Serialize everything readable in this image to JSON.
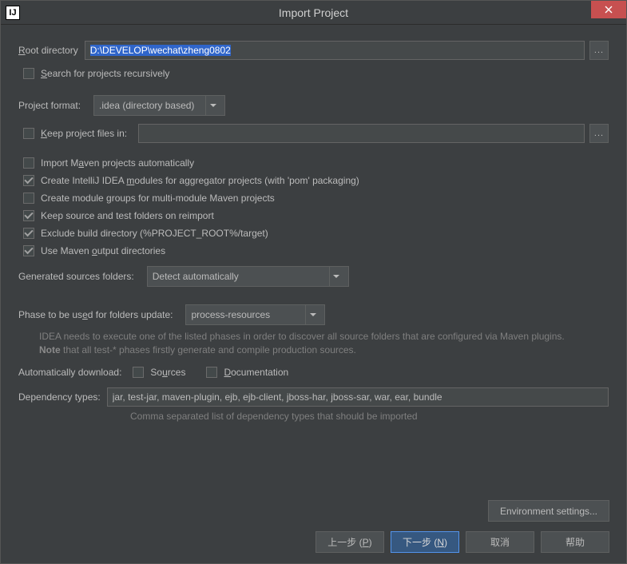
{
  "window": {
    "title": "Import Project",
    "app_icon_text": "IJ"
  },
  "root": {
    "label_prefix": "R",
    "label_rest": "oot directory",
    "value": "D:\\DEVELOP\\wechat\\zheng0802",
    "browse": "..."
  },
  "search_recursive": {
    "label_prefix": "S",
    "label_rest": "earch for projects recursively"
  },
  "project_format": {
    "label": "Project format:",
    "value": ".idea (directory based)"
  },
  "keep_files": {
    "label_prefix": "K",
    "label_rest": "eep project files in:",
    "value": "",
    "browse": "..."
  },
  "maven_opts": {
    "auto_import_pre": "Import M",
    "auto_import_u": "a",
    "auto_import_post": "ven projects automatically",
    "aggregator_pre": "Create IntelliJ IDEA ",
    "aggregator_u": "m",
    "aggregator_post": "odules for aggregator projects (with 'pom' packaging)",
    "module_groups": "Create module groups for multi-module Maven projects",
    "keep_source": "Keep source and test folders on reimport",
    "exclude_build": "Exclude build directory (%PROJECT_ROOT%/target)",
    "use_output_pre": "Use Maven ",
    "use_output_u": "o",
    "use_output_post": "utput directories"
  },
  "generated_sources": {
    "label": "Generated sources folders:",
    "value": "Detect automatically"
  },
  "phase": {
    "label_pre": "Phase to be us",
    "label_u": "e",
    "label_post": "d for folders update:",
    "value": "process-resources",
    "hint1": "IDEA needs to execute one of the listed phases in order to discover all source folders that are configured via Maven plugins.",
    "hint2_bold": "Note",
    "hint2_rest": " that all test-* phases firstly generate and compile production sources."
  },
  "auto_download": {
    "label": "Automatically download:",
    "sources_pre": "So",
    "sources_u": "u",
    "sources_post": "rces",
    "docs_u": "D",
    "docs_post": "ocumentation"
  },
  "dependency": {
    "label": "Dependency types:",
    "value": "jar, test-jar, maven-plugin, ejb, ejb-client, jboss-har, jboss-sar, war, ear, bundle",
    "hint": "Comma separated list of dependency types that should be imported"
  },
  "buttons": {
    "env": "Environment settings...",
    "prev": "上一步 (P)",
    "next": "下一步 (N)",
    "cancel": "取消",
    "help": "帮助"
  }
}
